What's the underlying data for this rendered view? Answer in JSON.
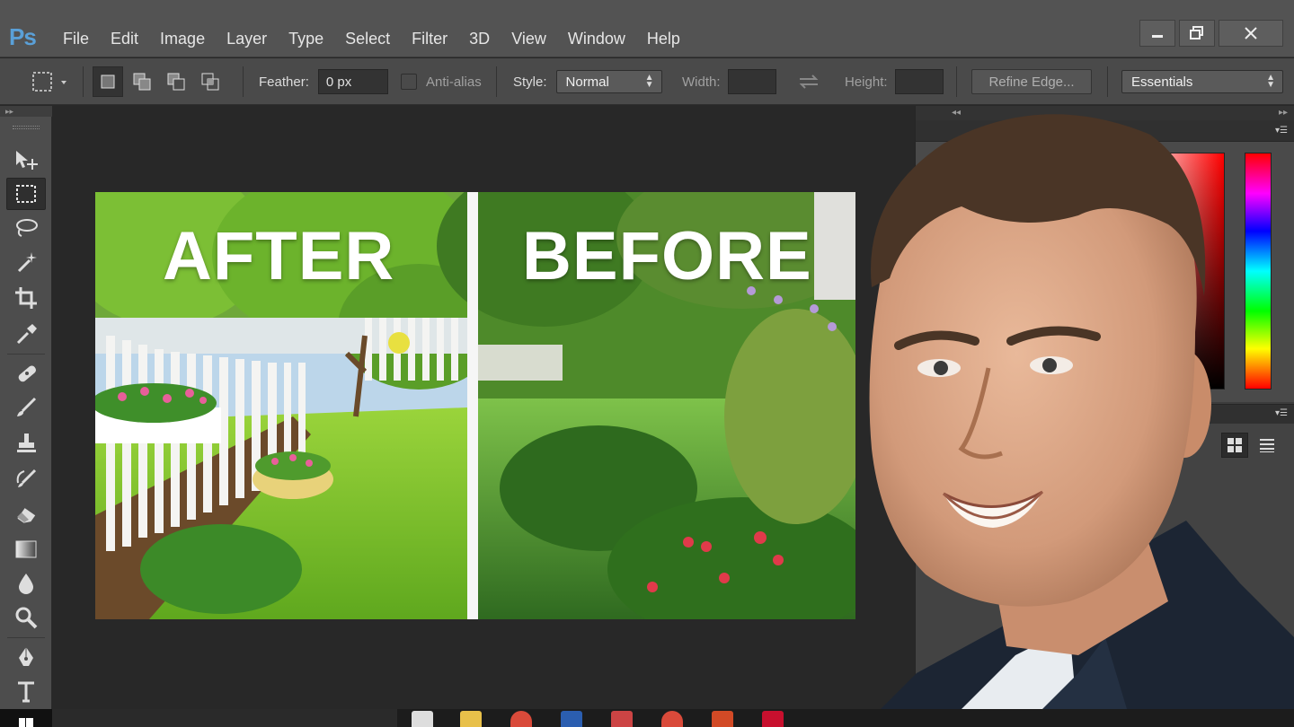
{
  "app": {
    "logo": "Ps",
    "menu": [
      "File",
      "Edit",
      "Image",
      "Layer",
      "Type",
      "Select",
      "Filter",
      "3D",
      "View",
      "Window",
      "Help"
    ],
    "window_controls": {
      "minimize": "–",
      "restore": "❐",
      "close": "✕"
    }
  },
  "options_bar": {
    "feather_label": "Feather:",
    "feather_value": "0 px",
    "anti_alias_label": "Anti-alias",
    "style_label": "Style:",
    "style_value": "Normal",
    "width_label": "Width:",
    "width_value": "",
    "height_label": "Height:",
    "height_value": "",
    "refine_edge_label": "Refine Edge...",
    "workspace_value": "Essentials"
  },
  "toolbar": {
    "tools": [
      "move-tool",
      "rectangular-marquee-tool",
      "lasso-tool",
      "magic-wand-tool",
      "crop-tool",
      "eyedropper-tool",
      "spot-healing-tool",
      "brush-tool",
      "clone-stamp-tool",
      "history-brush-tool",
      "eraser-tool",
      "gradient-tool",
      "blur-tool",
      "dodge-tool",
      "pen-tool",
      "type-tool"
    ],
    "active_tool": "rectangular-marquee-tool"
  },
  "canvas": {
    "after_label": "AFTER",
    "before_label": "BEFORE"
  },
  "colors": {
    "menubar_bg": "#535353",
    "optionsbar_bg": "#4a4a4a",
    "workspace_bg": "#282828",
    "ps_logo": "#5aa0d8"
  }
}
